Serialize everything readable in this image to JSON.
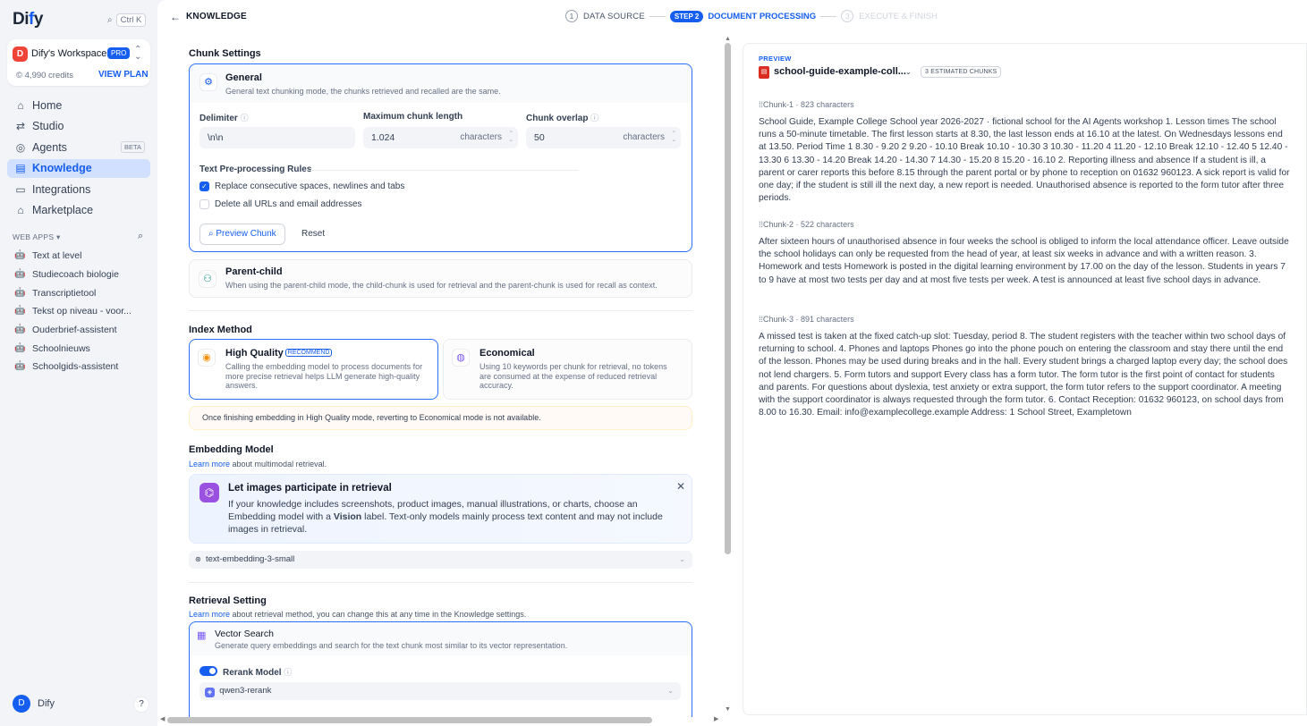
{
  "sidebar": {
    "logo": "Dify",
    "search_shortcut": "Ctrl K",
    "workspace": {
      "avatar": "D",
      "name": "Dify's Workspace",
      "badge": "PRO",
      "credits": "4,990 credits",
      "view_plan": "VIEW PLAN"
    },
    "nav": [
      {
        "label": "Home",
        "icon": "home-icon"
      },
      {
        "label": "Studio",
        "icon": "studio-icon"
      },
      {
        "label": "Agents",
        "icon": "agent-icon",
        "badge": "BETA"
      },
      {
        "label": "Knowledge",
        "icon": "book-icon",
        "active": true
      },
      {
        "label": "Integrations",
        "icon": "integrations-icon"
      },
      {
        "label": "Marketplace",
        "icon": "store-icon"
      }
    ],
    "web_apps_label": "WEB APPS",
    "apps": [
      "Text at level",
      "Studiecoach biologie",
      "Transcriptietool",
      "Tekst op niveau - voor...",
      "Ouderbrief-assistent",
      "Schoolnieuws",
      "Schoolgids-assistent"
    ],
    "user": {
      "avatar": "D",
      "name": "Dify",
      "help": "?"
    }
  },
  "header": {
    "back_title": "KNOWLEDGE",
    "steps": [
      {
        "num": "1",
        "label": "DATA SOURCE"
      },
      {
        "num": "STEP 2",
        "label": "DOCUMENT PROCESSING"
      },
      {
        "num": "3",
        "label": "EXECUTE & FINISH"
      }
    ]
  },
  "chunk_settings": {
    "title": "Chunk Settings",
    "general": {
      "title": "General",
      "desc": "General text chunking mode, the chunks retrieved and recalled are the same."
    },
    "delimiter_label": "Delimiter",
    "delimiter_value": "\\n\\n",
    "max_len_label": "Maximum chunk length",
    "max_len_value": "1.024",
    "overlap_label": "Chunk overlap",
    "overlap_value": "50",
    "unit": "characters",
    "rules_title": "Text Pre-processing Rules",
    "rule1": "Replace consecutive spaces, newlines and tabs",
    "rule2": "Delete all URLs and email addresses",
    "preview_btn": "Preview Chunk",
    "reset_btn": "Reset",
    "parent_child": {
      "title": "Parent-child",
      "desc": "When using the parent-child mode, the child-chunk is used for retrieval and the parent-chunk is used for recall as context."
    }
  },
  "index_method": {
    "title": "Index Method",
    "high": {
      "title": "High Quality",
      "badge": "RECOMMEND",
      "desc": "Calling the embedding model to process documents for more precise retrieval helps LLM generate high-quality answers."
    },
    "eco": {
      "title": "Economical",
      "desc": "Using 10 keywords per chunk for retrieval, no tokens are consumed at the expense of reduced retrieval accuracy."
    },
    "notice": "Once finishing embedding in High Quality mode, reverting to Economical mode is not available."
  },
  "embedding": {
    "title": "Embedding Model",
    "learn": "Learn more",
    "learn_rest": " about multimodal retrieval.",
    "banner_title": "Let images participate in retrieval",
    "banner_d1": "If your knowledge includes screenshots, product images, manual illustrations, or charts, choose an Embedding model with a ",
    "banner_bold": "Vision",
    "banner_d2": " label. Text-only models mainly process text content and may not include images in retrieval.",
    "model": "text-embedding-3-small"
  },
  "retrieval": {
    "title": "Retrieval Setting",
    "learn": "Learn more",
    "learn_rest": " about retrieval method, you can change this at any time in the Knowledge settings.",
    "vector_title": "Vector Search",
    "vector_desc": "Generate query embeddings and search for the text chunk most similar to its vector representation.",
    "rerank_label": "Rerank Model",
    "rerank_model": "qwen3-rerank"
  },
  "preview": {
    "label": "PREVIEW",
    "file": "school-guide-example-coll...",
    "estimated": "3 ESTIMATED CHUNKS",
    "chunks": [
      {
        "name": "Chunk-1",
        "chars": "823 characters",
        "text": "School Guide, Example College School year 2026-2027 · fictional school for the AI Agents workshop 1. Lesson times The school runs a 50-minute timetable. The first lesson starts at 8.30, the last lesson ends at 16.10 at the latest. On Wednesdays lessons end at 13.50. Period Time 1 8.30 - 9.20 2 9.20 - 10.10 Break 10.10 - 10.30 3 10.30 - 11.20 4 11.20 - 12.10 Break 12.10 - 12.40 5 12.40 - 13.30 6 13.30 - 14.20 Break 14.20 - 14.30 7 14.30 - 15.20 8 15.20 - 16.10 2. Reporting illness and absence If a student is ill, a parent or carer reports this before 8.15 through the parent portal or by phone to reception on 01632 960123. A sick report is valid for one day; if the student is still ill the next day, a new report is needed. Unauthorised absence is reported to the form tutor after three periods."
      },
      {
        "name": "Chunk-2",
        "chars": "522 characters",
        "text": "After sixteen hours of unauthorised absence in four weeks the school is obliged to inform the local attendance officer. Leave outside the school holidays can only be requested from the head of year, at least six weeks in advance and with a written reason. 3. Homework and tests Homework is posted in the digital learning environment by 17.00 on the day of the lesson. Students in years 7 to 9 have at most two tests per day and at most five tests per week. A test is announced at least five school days in advance."
      },
      {
        "name": "Chunk-3",
        "chars": "891 characters",
        "text": "A missed test is taken at the fixed catch-up slot: Tuesday, period 8. The student registers with the teacher within two school days of returning to school. 4. Phones and laptops Phones go into the phone pouch on entering the classroom and stay there until the end of the lesson. Phones may be used during breaks and in the hall. Every student brings a charged laptop every day; the school does not lend chargers. 5. Form tutors and support Every class has a form tutor. The form tutor is the first point of contact for students and parents. For questions about dyslexia, test anxiety or extra support, the form tutor refers to the support coordinator. A meeting with the support coordinator is always requested through the form tutor. 6. Contact Reception: 01632 960123, on school days from 8.00 to 16.30. Email: info@examplecollege.example Address: 1 School Street, Exampletown"
      }
    ]
  }
}
